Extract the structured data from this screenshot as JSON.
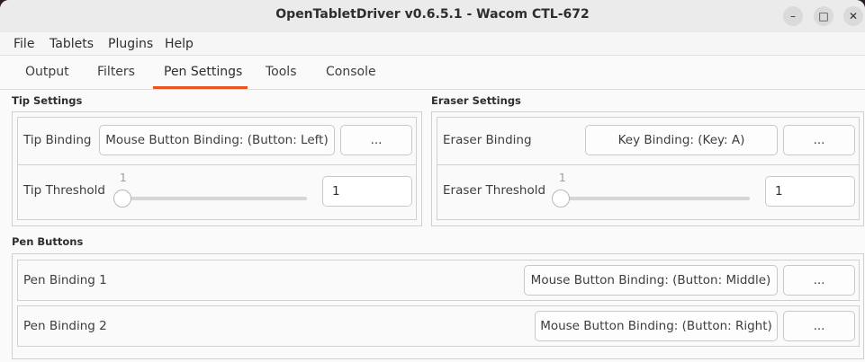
{
  "window": {
    "title": "OpenTabletDriver v0.6.5.1 - Wacom CTL-672",
    "controls": {
      "minimize": "–",
      "maximize": "□",
      "close": "✕"
    }
  },
  "menu": [
    "File",
    "Tablets",
    "Plugins",
    "Help"
  ],
  "tabs": [
    {
      "label": "Output",
      "active": false
    },
    {
      "label": "Filters",
      "active": false
    },
    {
      "label": "Pen Settings",
      "active": true
    },
    {
      "label": "Tools",
      "active": false
    },
    {
      "label": "Console",
      "active": false
    }
  ],
  "accent_color": "#e95420",
  "tip": {
    "section_title": "Tip Settings",
    "binding_label": "Tip Binding",
    "binding_value": "Mouse Button Binding: (Button: Left)",
    "more_label": "...",
    "threshold_label": "Tip Threshold",
    "threshold_slider_value": "1",
    "threshold_input": "1"
  },
  "eraser": {
    "section_title": "Eraser Settings",
    "binding_label": "Eraser Binding",
    "binding_value": "Key Binding: (Key: A)",
    "more_label": "...",
    "threshold_label": "Eraser Threshold",
    "threshold_slider_value": "1",
    "threshold_input": "1"
  },
  "pen_buttons": {
    "section_title": "Pen Buttons",
    "items": [
      {
        "label": "Pen Binding 1",
        "value": "Mouse Button Binding: (Button: Middle)",
        "more_label": "..."
      },
      {
        "label": "Pen Binding 2",
        "value": "Mouse Button Binding: (Button: Right)",
        "more_label": "..."
      }
    ]
  }
}
